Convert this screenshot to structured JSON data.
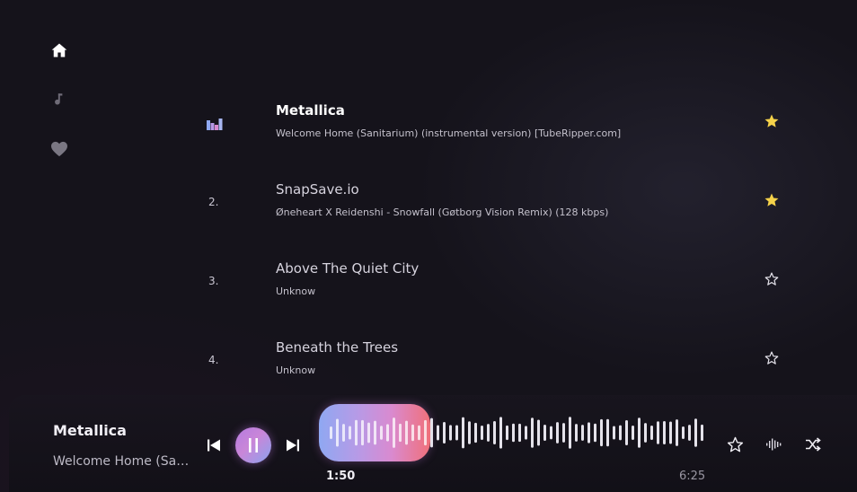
{
  "sidebar": {
    "items": [
      {
        "icon": "home-icon",
        "active": true
      },
      {
        "icon": "music-note-icon",
        "active": false
      },
      {
        "icon": "heart-icon",
        "active": false
      }
    ]
  },
  "tracks": [
    {
      "number": "",
      "title": "Metallica",
      "subtitle": "Welcome Home (Sanitarium) (instrumental version) [TubeRipper.com]",
      "favorite": true,
      "playing": true
    },
    {
      "number": "2.",
      "title": "SnapSave.io",
      "subtitle": "Øneheart X Reidenshi - Snowfall (Gøtborg Vision Remix) (128 kbps)",
      "favorite": true,
      "playing": false
    },
    {
      "number": "3.",
      "title": "Above The Quiet City",
      "subtitle": "Unknow",
      "favorite": false,
      "playing": false
    },
    {
      "number": "4.",
      "title": "Beneath the Trees",
      "subtitle": "Unknow",
      "favorite": false,
      "playing": false
    }
  ],
  "player": {
    "title": "Metallica",
    "artist": "Welcome Home (Sanitarium) (instrumental version) [TubeRipper.com]",
    "current_time": "1:50",
    "total_time": "6:25",
    "progress": 0.286,
    "favorite": false
  },
  "colors": {
    "star_filled": "#f5d24a",
    "star_outline": "#e6e4ec",
    "accent_start": "#8fa8f2",
    "accent_end": "#f0707a"
  }
}
